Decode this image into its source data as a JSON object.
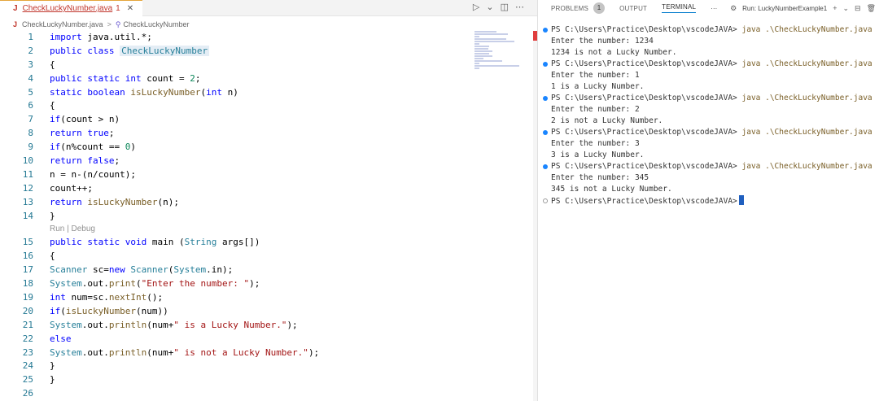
{
  "editor": {
    "tab": {
      "icon_letter": "J",
      "filename": "CheckLuckyNumber.java",
      "problem_count": "1",
      "close_glyph": "✕"
    },
    "breadcrumb": {
      "file": "CheckLuckyNumber.java",
      "separator": ">",
      "symbol": "CheckLuckyNumber"
    },
    "actions": {
      "run": "▷",
      "run_menu": "⌄",
      "split": "◫",
      "more": "⋯"
    },
    "codelens": "Run | Debug",
    "lines": [
      {
        "n": "1",
        "t": "import java.util.*;"
      },
      {
        "n": "2",
        "t": "public class CheckLuckyNumber"
      },
      {
        "n": "3",
        "t": "{"
      },
      {
        "n": "4",
        "t": "public static int count = 2;"
      },
      {
        "n": "5",
        "t": "static boolean isLuckyNumber(int n)"
      },
      {
        "n": "6",
        "t": "{"
      },
      {
        "n": "7",
        "t": "if(count > n)"
      },
      {
        "n": "8",
        "t": "return true;"
      },
      {
        "n": "9",
        "t": "if(n%count == 0)"
      },
      {
        "n": "10",
        "t": "return false;"
      },
      {
        "n": "11",
        "t": "n = n-(n/count);"
      },
      {
        "n": "12",
        "t": "count++;"
      },
      {
        "n": "13",
        "t": "return isLuckyNumber(n);"
      },
      {
        "n": "14",
        "t": "}"
      },
      {
        "n": "15",
        "t": "public static void main (String args[])"
      },
      {
        "n": "16",
        "t": "{"
      },
      {
        "n": "17",
        "t": "Scanner sc=new Scanner(System.in);"
      },
      {
        "n": "18",
        "t": "System.out.print(\"Enter the number: \");"
      },
      {
        "n": "19",
        "t": "int num=sc.nextInt();"
      },
      {
        "n": "20",
        "t": "if(isLuckyNumber(num))"
      },
      {
        "n": "21",
        "t": "System.out.println(num+\" is a Lucky Number.\");"
      },
      {
        "n": "22",
        "t": "else"
      },
      {
        "n": "23",
        "t": "System.out.println(num+\" is not a Lucky Number.\");"
      },
      {
        "n": "24",
        "t": "}"
      },
      {
        "n": "25",
        "t": "}"
      },
      {
        "n": "26",
        "t": ""
      }
    ]
  },
  "panel": {
    "tabs": [
      {
        "label": "PROBLEMS",
        "badge": "1"
      },
      {
        "label": "OUTPUT"
      },
      {
        "label": "TERMINAL",
        "active": true
      }
    ],
    "more": "⋯",
    "run_config_icon": "⚙",
    "run_config": "Run: LuckyNumberExample1",
    "add": "+",
    "add_menu": "⌄",
    "split": "⊟",
    "trash": "🗑"
  },
  "terminal": {
    "prompt": "PS C:\\Users\\Practice\\Desktop\\vscodeJAVA>",
    "command": "java .\\CheckLuckyNumber.java",
    "runs": [
      {
        "prompt": "Enter the number: 1234",
        "result": "1234 is not a Lucky Number."
      },
      {
        "prompt": "Enter the number: 1",
        "result": "1 is a Lucky Number."
      },
      {
        "prompt": "Enter the number: 2",
        "result": "2 is not a Lucky Number."
      },
      {
        "prompt": "Enter the number: 3",
        "result": "3 is a Lucky Number."
      },
      {
        "prompt": "Enter the number: 345",
        "result": "345 is not a Lucky Number."
      }
    ]
  },
  "colors": {
    "keyword": "#0000ff",
    "type": "#267f99",
    "string": "#a31515",
    "number": "#098658",
    "line_number": "#237893",
    "error_tab": "#c0352b",
    "accent": "#007acc"
  }
}
